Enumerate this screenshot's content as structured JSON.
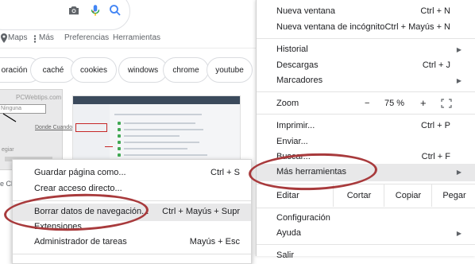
{
  "google": {
    "tabs": [
      {
        "label": "Maps"
      },
      {
        "label": "Más"
      },
      {
        "label": "Preferencias"
      },
      {
        "label": "Herramientas"
      }
    ],
    "chips": [
      "oración",
      "caché",
      "cookies",
      "windows",
      "chrome",
      "youtube"
    ],
    "thumb_text": {
      "site": "PCWebtips.com",
      "select": "Ninguna",
      "link": "Donde Cuando",
      "side": "egiar",
      "edge": "e Ch"
    }
  },
  "context_submenu": {
    "items": [
      {
        "label": "Guardar página como...",
        "shortcut": "Ctrl + S"
      },
      {
        "label": "Crear acceso directo...",
        "shortcut": ""
      },
      {
        "label": "Borrar datos de navegación...",
        "shortcut": "Ctrl + Mayús + Supr"
      },
      {
        "label": "Extensiones",
        "shortcut": ""
      },
      {
        "label": "Administrador de tareas",
        "shortcut": "Mayús + Esc"
      }
    ]
  },
  "chrome_menu": {
    "new_window": {
      "label": "Nueva ventana",
      "shortcut": "Ctrl + N"
    },
    "incognito": {
      "label": "Nueva ventana de incógnito",
      "shortcut": "Ctrl + Mayús + N"
    },
    "history": {
      "label": "Historial"
    },
    "downloads": {
      "label": "Descargas",
      "shortcut": "Ctrl + J"
    },
    "bookmarks": {
      "label": "Marcadores"
    },
    "zoom": {
      "label": "Zoom",
      "minus": "−",
      "value": "75 %",
      "plus": "+"
    },
    "print": {
      "label": "Imprimir...",
      "shortcut": "Ctrl + P"
    },
    "send": {
      "label": "Enviar..."
    },
    "find": {
      "label": "Buscar...",
      "shortcut": "Ctrl + F"
    },
    "more_tools": {
      "label": "Más herramientas"
    },
    "edit": {
      "label": "Editar",
      "cut": "Cortar",
      "copy": "Copiar",
      "paste": "Pegar"
    },
    "settings": {
      "label": "Configuración"
    },
    "help": {
      "label": "Ayuda"
    },
    "exit": {
      "label": "Salir"
    }
  },
  "colors": {
    "annotation": "#a83a3c",
    "highlight": "#e8e8e9",
    "google_blue": "#4285f4"
  }
}
